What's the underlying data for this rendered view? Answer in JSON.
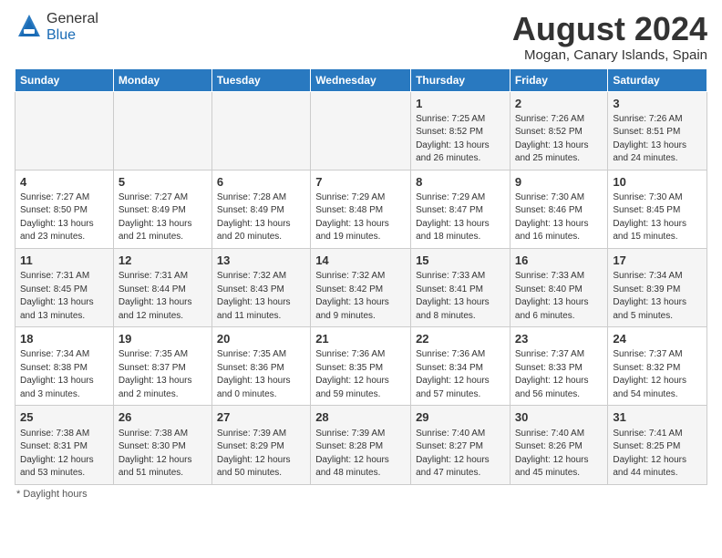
{
  "logo": {
    "general": "General",
    "blue": "Blue"
  },
  "title": "August 2024",
  "location": "Mogan, Canary Islands, Spain",
  "days_header": [
    "Sunday",
    "Monday",
    "Tuesday",
    "Wednesday",
    "Thursday",
    "Friday",
    "Saturday"
  ],
  "footer": "Daylight hours",
  "weeks": [
    [
      {
        "day": "",
        "info": ""
      },
      {
        "day": "",
        "info": ""
      },
      {
        "day": "",
        "info": ""
      },
      {
        "day": "",
        "info": ""
      },
      {
        "day": "1",
        "info": "Sunrise: 7:25 AM\nSunset: 8:52 PM\nDaylight: 13 hours\nand 26 minutes."
      },
      {
        "day": "2",
        "info": "Sunrise: 7:26 AM\nSunset: 8:52 PM\nDaylight: 13 hours\nand 25 minutes."
      },
      {
        "day": "3",
        "info": "Sunrise: 7:26 AM\nSunset: 8:51 PM\nDaylight: 13 hours\nand 24 minutes."
      }
    ],
    [
      {
        "day": "4",
        "info": "Sunrise: 7:27 AM\nSunset: 8:50 PM\nDaylight: 13 hours\nand 23 minutes."
      },
      {
        "day": "5",
        "info": "Sunrise: 7:27 AM\nSunset: 8:49 PM\nDaylight: 13 hours\nand 21 minutes."
      },
      {
        "day": "6",
        "info": "Sunrise: 7:28 AM\nSunset: 8:49 PM\nDaylight: 13 hours\nand 20 minutes."
      },
      {
        "day": "7",
        "info": "Sunrise: 7:29 AM\nSunset: 8:48 PM\nDaylight: 13 hours\nand 19 minutes."
      },
      {
        "day": "8",
        "info": "Sunrise: 7:29 AM\nSunset: 8:47 PM\nDaylight: 13 hours\nand 18 minutes."
      },
      {
        "day": "9",
        "info": "Sunrise: 7:30 AM\nSunset: 8:46 PM\nDaylight: 13 hours\nand 16 minutes."
      },
      {
        "day": "10",
        "info": "Sunrise: 7:30 AM\nSunset: 8:45 PM\nDaylight: 13 hours\nand 15 minutes."
      }
    ],
    [
      {
        "day": "11",
        "info": "Sunrise: 7:31 AM\nSunset: 8:45 PM\nDaylight: 13 hours\nand 13 minutes."
      },
      {
        "day": "12",
        "info": "Sunrise: 7:31 AM\nSunset: 8:44 PM\nDaylight: 13 hours\nand 12 minutes."
      },
      {
        "day": "13",
        "info": "Sunrise: 7:32 AM\nSunset: 8:43 PM\nDaylight: 13 hours\nand 11 minutes."
      },
      {
        "day": "14",
        "info": "Sunrise: 7:32 AM\nSunset: 8:42 PM\nDaylight: 13 hours\nand 9 minutes."
      },
      {
        "day": "15",
        "info": "Sunrise: 7:33 AM\nSunset: 8:41 PM\nDaylight: 13 hours\nand 8 minutes."
      },
      {
        "day": "16",
        "info": "Sunrise: 7:33 AM\nSunset: 8:40 PM\nDaylight: 13 hours\nand 6 minutes."
      },
      {
        "day": "17",
        "info": "Sunrise: 7:34 AM\nSunset: 8:39 PM\nDaylight: 13 hours\nand 5 minutes."
      }
    ],
    [
      {
        "day": "18",
        "info": "Sunrise: 7:34 AM\nSunset: 8:38 PM\nDaylight: 13 hours\nand 3 minutes."
      },
      {
        "day": "19",
        "info": "Sunrise: 7:35 AM\nSunset: 8:37 PM\nDaylight: 13 hours\nand 2 minutes."
      },
      {
        "day": "20",
        "info": "Sunrise: 7:35 AM\nSunset: 8:36 PM\nDaylight: 13 hours\nand 0 minutes."
      },
      {
        "day": "21",
        "info": "Sunrise: 7:36 AM\nSunset: 8:35 PM\nDaylight: 12 hours\nand 59 minutes."
      },
      {
        "day": "22",
        "info": "Sunrise: 7:36 AM\nSunset: 8:34 PM\nDaylight: 12 hours\nand 57 minutes."
      },
      {
        "day": "23",
        "info": "Sunrise: 7:37 AM\nSunset: 8:33 PM\nDaylight: 12 hours\nand 56 minutes."
      },
      {
        "day": "24",
        "info": "Sunrise: 7:37 AM\nSunset: 8:32 PM\nDaylight: 12 hours\nand 54 minutes."
      }
    ],
    [
      {
        "day": "25",
        "info": "Sunrise: 7:38 AM\nSunset: 8:31 PM\nDaylight: 12 hours\nand 53 minutes."
      },
      {
        "day": "26",
        "info": "Sunrise: 7:38 AM\nSunset: 8:30 PM\nDaylight: 12 hours\nand 51 minutes."
      },
      {
        "day": "27",
        "info": "Sunrise: 7:39 AM\nSunset: 8:29 PM\nDaylight: 12 hours\nand 50 minutes."
      },
      {
        "day": "28",
        "info": "Sunrise: 7:39 AM\nSunset: 8:28 PM\nDaylight: 12 hours\nand 48 minutes."
      },
      {
        "day": "29",
        "info": "Sunrise: 7:40 AM\nSunset: 8:27 PM\nDaylight: 12 hours\nand 47 minutes."
      },
      {
        "day": "30",
        "info": "Sunrise: 7:40 AM\nSunset: 8:26 PM\nDaylight: 12 hours\nand 45 minutes."
      },
      {
        "day": "31",
        "info": "Sunrise: 7:41 AM\nSunset: 8:25 PM\nDaylight: 12 hours\nand 44 minutes."
      }
    ]
  ]
}
